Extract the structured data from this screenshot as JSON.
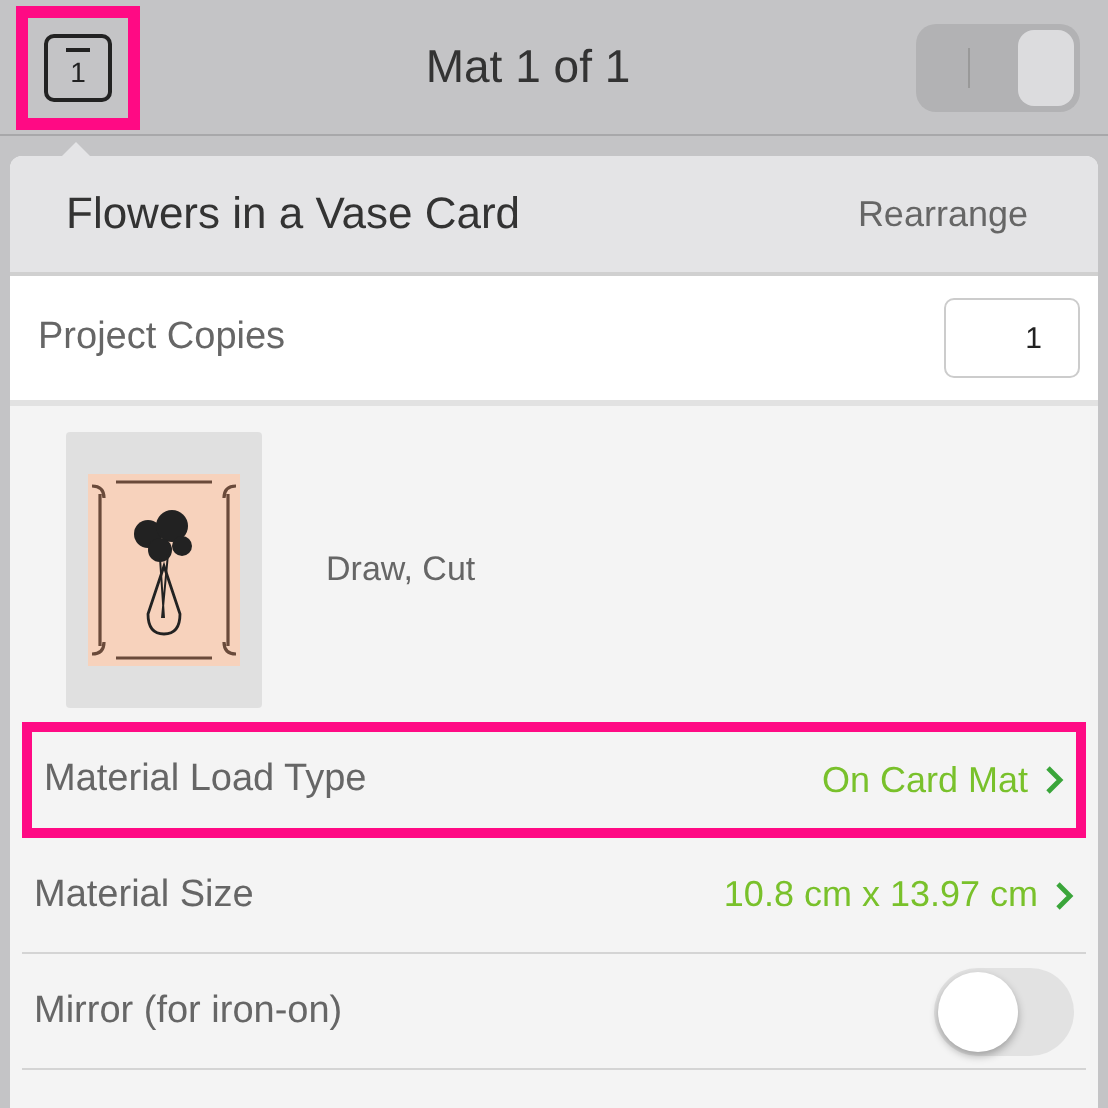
{
  "top_bar": {
    "mat_button": {
      "label": "1",
      "highlighted": true
    },
    "title": "Mat 1 of 1",
    "view_toggle": {
      "on": true
    }
  },
  "project": {
    "title": "Flowers in a Vase Card",
    "action": "Rearrange"
  },
  "copies": {
    "label": "Project Copies",
    "value": "1"
  },
  "mat_preview": {
    "operations": "Draw, Cut"
  },
  "settings": [
    {
      "kind": "link",
      "label": "Material Load Type",
      "value": "On Card Mat",
      "highlighted": true
    },
    {
      "kind": "link",
      "label": "Material Size",
      "value": "10.8 cm x 13.97 cm",
      "highlighted": false
    },
    {
      "kind": "switch",
      "label": "Mirror (for iron-on)",
      "on": false,
      "highlighted": false
    }
  ]
}
